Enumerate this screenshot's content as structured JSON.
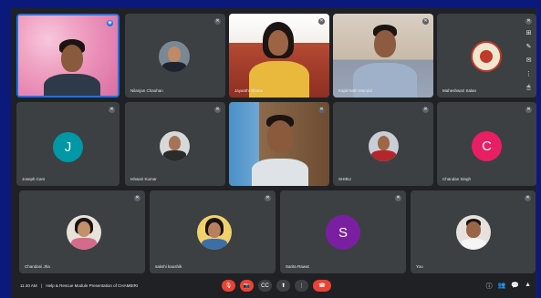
{
  "colors": {
    "outer_border": "#0b1a7a",
    "background": "#202124",
    "tile": "#3c4043",
    "end_call": "#ea4335",
    "avatar_j": "#0097a7",
    "avatar_c": "#e91e63",
    "avatar_s": "#7b1fa2",
    "active_speaker": "#1a73e8"
  },
  "participants": {
    "p1": {
      "name": ""
    },
    "p2": {
      "name": "Nilanjan Chauhan"
    },
    "p3": {
      "name": "Jayanthi Bhanu"
    },
    "p4": {
      "name": "Kajal Nath Mandal"
    },
    "p5": {
      "name": "Maheshwari Salan"
    },
    "p6": {
      "name": "Joseph Cars",
      "initial": "J"
    },
    "p7": {
      "name": "Ishwari Kumar"
    },
    "p8": {
      "name": ""
    },
    "p9": {
      "name": "SHIBU"
    },
    "p10": {
      "name": "Chandan Singh",
      "initial": "C"
    },
    "p11": {
      "name": "Chandani Jha"
    },
    "p12": {
      "name": "sakshi kaushik"
    },
    "p13": {
      "name": "Sarita Rawat",
      "initial": "S"
    },
    "p14": {
      "name": "You"
    }
  },
  "mic_icon": "mic-off-icon",
  "meeting": {
    "time": "11:40 AM",
    "separator": "|",
    "title": "Help & Rescue Module Presentation of CHAMBIRI"
  },
  "controls": {
    "mic": "🎙",
    "camera": "📷",
    "captions": "CC",
    "present": "⬆",
    "more": "⋮",
    "end": "☎"
  },
  "side_icons": {
    "grid": "⊞",
    "pen": "✎",
    "message": "✉",
    "more": "⋮",
    "mouse": "🖱"
  },
  "right_icons": {
    "info": "ⓘ",
    "people": "👥",
    "chat": "💬",
    "activities": "▲"
  }
}
